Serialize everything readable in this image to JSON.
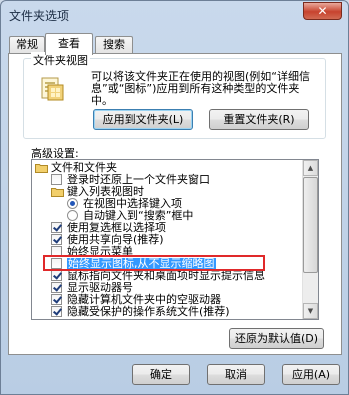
{
  "window": {
    "title": "文件夹选项",
    "close_glyph": "✕"
  },
  "tabs": [
    {
      "label": "常规",
      "active": false
    },
    {
      "label": "查看",
      "active": true
    },
    {
      "label": "搜索",
      "active": false
    }
  ],
  "folder_views": {
    "legend": "文件夹视图",
    "description": "可以将该文件夹正在使用的视图(例如“详细信息”或“图标”)应用到所有这种类型的文件夹中。",
    "apply_button": "应用到文件夹(L)",
    "reset_button": "重置文件夹(R)"
  },
  "advanced": {
    "label": "高级设置:",
    "items": [
      {
        "kind": "folder",
        "indent": 0,
        "text": "文件和文件夹"
      },
      {
        "kind": "checkbox",
        "indent": 1,
        "checked": false,
        "text": "登录时还原上一个文件夹窗口"
      },
      {
        "kind": "folder",
        "indent": 1,
        "text": "键入列表视图时"
      },
      {
        "kind": "radio",
        "indent": 2,
        "checked": true,
        "text": "在视图中选择键入项"
      },
      {
        "kind": "radio",
        "indent": 2,
        "checked": false,
        "text": "自动键入到“搜索”框中"
      },
      {
        "kind": "checkbox",
        "indent": 1,
        "checked": true,
        "text": "使用复选框以选择项"
      },
      {
        "kind": "checkbox",
        "indent": 1,
        "checked": true,
        "text": "使用共享向导(推荐)"
      },
      {
        "kind": "checkbox",
        "indent": 1,
        "checked": false,
        "text": "始终显示菜单"
      },
      {
        "kind": "checkbox",
        "indent": 1,
        "checked": false,
        "text": "始终显示图标,从不显示缩略图",
        "selected": true
      },
      {
        "kind": "checkbox",
        "indent": 1,
        "checked": true,
        "text": "鼠标指向文件夹和桌面项时显示提示信息"
      },
      {
        "kind": "checkbox",
        "indent": 1,
        "checked": true,
        "text": "显示驱动器号"
      },
      {
        "kind": "checkbox",
        "indent": 1,
        "checked": true,
        "text": "隐藏计算机文件夹中的空驱动器"
      },
      {
        "kind": "checkbox",
        "indent": 1,
        "checked": true,
        "text": "隐藏受保护的操作系统文件(推荐)"
      }
    ],
    "restore_button": "还原为默认值(D)"
  },
  "footer": {
    "ok": "确定",
    "cancel": "取消",
    "apply": "应用(A)"
  },
  "colors": {
    "selection": "#3399ff",
    "highlight_border": "#e0292a"
  }
}
